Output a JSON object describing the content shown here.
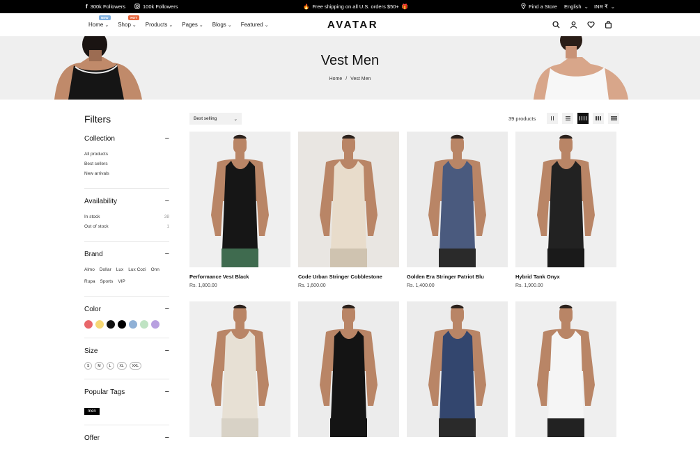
{
  "topbar": {
    "facebook": "300k Followers",
    "instagram": "100k Followers",
    "shipping": "Free shipping on all U.S. orders $50+",
    "find_store": "Find a Store",
    "language": "English",
    "currency": "INR ₹"
  },
  "nav": {
    "logo": "AVATAR",
    "menu": [
      {
        "label": "Home",
        "badge": "NEW",
        "badge_color": "#7fb0e0"
      },
      {
        "label": "Shop",
        "badge": "HOT",
        "badge_color": "#e8663c"
      },
      {
        "label": "Products"
      },
      {
        "label": "Pages"
      },
      {
        "label": "Blogs"
      },
      {
        "label": "Featured"
      }
    ]
  },
  "hero": {
    "title": "Vest Men",
    "crumb_home": "Home",
    "crumb_sep": "/",
    "crumb_current": "Vest Men"
  },
  "filters": {
    "title": "Filters",
    "collection": {
      "title": "Collection",
      "items": [
        "All products",
        "Best sellers",
        "New arrivals"
      ]
    },
    "availability": {
      "title": "Availability",
      "items": [
        {
          "label": "In stock",
          "count": "38"
        },
        {
          "label": "Out of stock",
          "count": "1"
        }
      ]
    },
    "brand": {
      "title": "Brand",
      "items": [
        "Almo",
        "Dollar",
        "Lux",
        "Lux Cozi",
        "Onn",
        "Rupa",
        "Sports",
        "VIP"
      ]
    },
    "color": {
      "title": "Color",
      "swatches": [
        "#e8676a",
        "#f6d874",
        "#111111",
        "#000000",
        "#8fb0d6",
        "#bfe3c3",
        "#b8a0e0"
      ]
    },
    "size": {
      "title": "Size",
      "items": [
        "S",
        "M",
        "L",
        "XL",
        "XXL"
      ]
    },
    "tags": {
      "title": "Popular Tags",
      "items": [
        "men"
      ]
    },
    "offer": {
      "title": "Offer"
    }
  },
  "toolbar": {
    "sort": "Best selling",
    "count": "39 products"
  },
  "products": [
    {
      "name": "Performance Vest Black",
      "price": "Rs. 1,800.00",
      "vest": "#161616",
      "shorts": "#3f6b4f",
      "bg": "#efefef"
    },
    {
      "name": "Code Urban Stringer Cobblestone",
      "price": "Rs. 1,600.00",
      "vest": "#e8dccb",
      "shorts": "#cfc3b0",
      "bg": "#e9e6e2"
    },
    {
      "name": "Golden Era Stringer Patriot Blu",
      "price": "Rs. 1,400.00",
      "vest": "#4a5a7e",
      "shorts": "#2a2a2a",
      "bg": "#ececec"
    },
    {
      "name": "Hybrid Tank Onyx",
      "price": "Rs. 1,900.00",
      "vest": "#222222",
      "shorts": "#1a1a1a",
      "bg": "#efefef"
    },
    {
      "name": "",
      "price": "",
      "vest": "#e7e0d4",
      "shorts": "#d8d2c6",
      "bg": "#efefef"
    },
    {
      "name": "",
      "price": "",
      "vest": "#141414",
      "shorts": "#141414",
      "bg": "#ececec"
    },
    {
      "name": "",
      "price": "",
      "vest": "#33466e",
      "shorts": "#2a2a2a",
      "bg": "#ececec"
    },
    {
      "name": "",
      "price": "",
      "vest": "#f5f5f5",
      "shorts": "#222222",
      "bg": "#efefef"
    }
  ]
}
